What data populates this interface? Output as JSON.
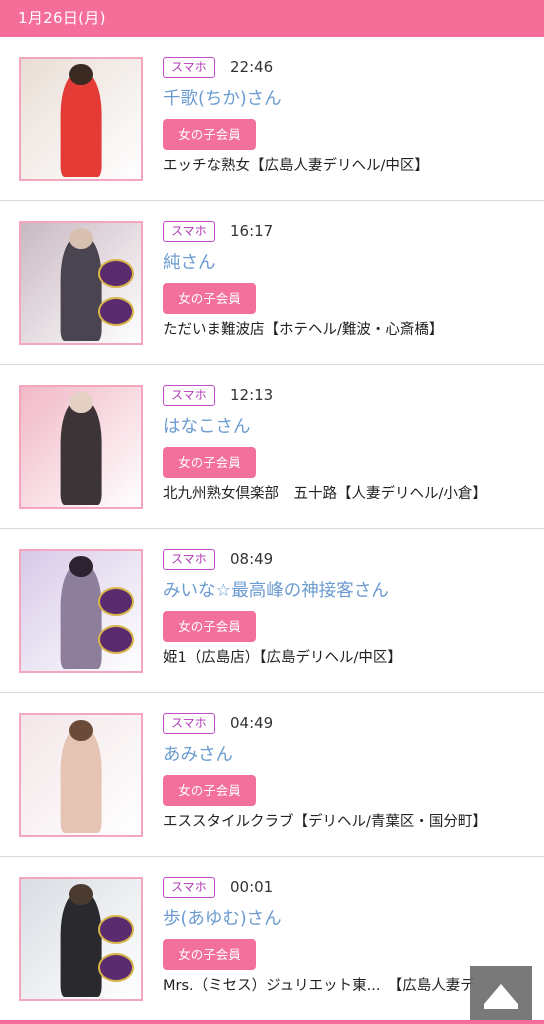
{
  "date_header": "1月26日(月)",
  "entries": [
    {
      "tag": "スマホ",
      "time": "22:46",
      "name": "千歌(ちか)さん",
      "member_label": "女の子会員",
      "shop": "エッチな熟女【広島人妻デリヘル/中区】",
      "thumb": {
        "bg": "#e9ded6",
        "figure": "#e53b36",
        "head": "#3a2a22",
        "deco": false
      }
    },
    {
      "tag": "スマホ",
      "time": "16:17",
      "name": "純さん",
      "member_label": "女の子会員",
      "shop": "ただいま難波店【ホテヘル/難波・心斎橋】",
      "thumb": {
        "bg": "#c9b9c2",
        "figure": "#4a4450",
        "head": "#d8c1b0",
        "deco": true
      }
    },
    {
      "tag": "スマホ",
      "time": "12:13",
      "name": "はなこさん",
      "member_label": "女の子会員",
      "shop": "北九州熟女倶楽部　五十路【人妻デリヘル/小倉】",
      "thumb": {
        "bg": "#f1b8c6",
        "figure": "#3c3436",
        "head": "#e5d0c4",
        "deco": false
      }
    },
    {
      "tag": "スマホ",
      "time": "08:49",
      "name": "みいな☆最高峰の神接客さん",
      "member_label": "女の子会員",
      "shop": "姫1（広島店）【広島デリヘル/中区】",
      "thumb": {
        "bg": "#d7c9e8",
        "figure": "#8d7f9c",
        "head": "#2c2230",
        "deco": true
      }
    },
    {
      "tag": "スマホ",
      "time": "04:49",
      "name": "あみさん",
      "member_label": "女の子会員",
      "shop": "エススタイルクラブ【デリヘル/青葉区・国分町】",
      "thumb": {
        "bg": "#f3e6e8",
        "figure": "#e6c4b3",
        "head": "#6a4a38",
        "deco": false
      }
    },
    {
      "tag": "スマホ",
      "time": "00:01",
      "name": "歩(あゆむ)さん",
      "member_label": "女の子会員",
      "shop": "Mrs.（ミセス）ジュリエット東...　【広島人妻デ",
      "thumb": {
        "bg": "#d9dde3",
        "figure": "#2a2a2e",
        "head": "#4a3a30",
        "deco": true
      }
    }
  ],
  "colors": {
    "accent": "#f56e9a",
    "tag_border": "#c249c8",
    "name": "#6b9bd1",
    "member_button": "#f2709b"
  },
  "icons": {
    "scroll_top": "up-triangle-icon"
  }
}
